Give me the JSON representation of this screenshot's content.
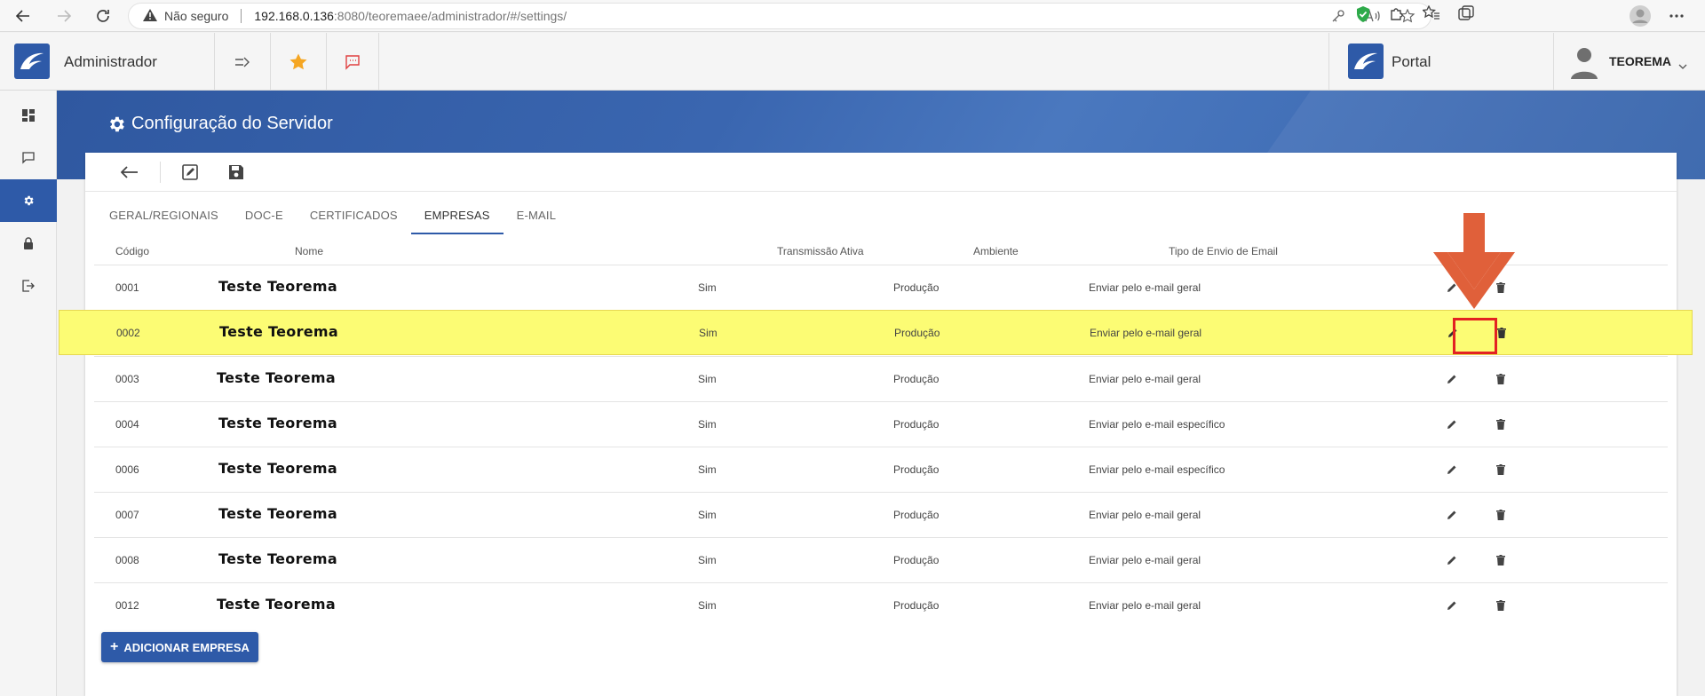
{
  "browser": {
    "security_warning": "Não seguro",
    "url_host": "192.168.0.136",
    "url_rest": ":8080/teoremaee/administrador/#/settings/"
  },
  "header": {
    "app_title": "Administrador",
    "portal_label": "Portal",
    "user_name": "TEOREMA"
  },
  "page": {
    "title": "Configuração do Servidor"
  },
  "tabs": [
    {
      "label": "GERAL/REGIONAIS"
    },
    {
      "label": "DOC-E"
    },
    {
      "label": "CERTIFICADOS"
    },
    {
      "label": "EMPRESAS"
    },
    {
      "label": "E-MAIL"
    }
  ],
  "active_tab": "EMPRESAS",
  "table": {
    "headers": {
      "code": "Código",
      "name": "Nome",
      "transmission": "Transmissão Ativa",
      "environment": "Ambiente",
      "email_type": "Tipo de Envio de Email"
    },
    "rows": [
      {
        "code": "0001",
        "name": "Teste Teorema",
        "transmission": "Sim",
        "environment": "Produção",
        "email_type": "Enviar pelo e-mail geral"
      },
      {
        "code": "0002",
        "name": "Teste Teorema",
        "transmission": "Sim",
        "environment": "Produção",
        "email_type": "Enviar pelo e-mail geral"
      },
      {
        "code": "0003",
        "name": "Teste Teorema",
        "transmission": "Sim",
        "environment": "Produção",
        "email_type": "Enviar pelo e-mail geral"
      },
      {
        "code": "0004",
        "name": "Teste Teorema",
        "transmission": "Sim",
        "environment": "Produção",
        "email_type": "Enviar pelo e-mail específico"
      },
      {
        "code": "0006",
        "name": "Teste Teorema",
        "transmission": "Sim",
        "environment": "Produção",
        "email_type": "Enviar pelo e-mail específico"
      },
      {
        "code": "0007",
        "name": "Teste Teorema",
        "transmission": "Sim",
        "environment": "Produção",
        "email_type": "Enviar pelo e-mail geral"
      },
      {
        "code": "0008",
        "name": "Teste Teorema",
        "transmission": "Sim",
        "environment": "Produção",
        "email_type": "Enviar pelo e-mail geral"
      },
      {
        "code": "0012",
        "name": "Teste Teorema",
        "transmission": "Sim",
        "environment": "Produção",
        "email_type": "Enviar pelo e-mail geral"
      }
    ]
  },
  "add_button": {
    "plus": "+",
    "label": "ADICIONAR EMPRESA"
  },
  "colors": {
    "brand": "#2e5aa8",
    "highlight": "#fcfc74",
    "annotation": "#e0603a",
    "annotation_box": "#e32222",
    "star": "#f5a623"
  }
}
